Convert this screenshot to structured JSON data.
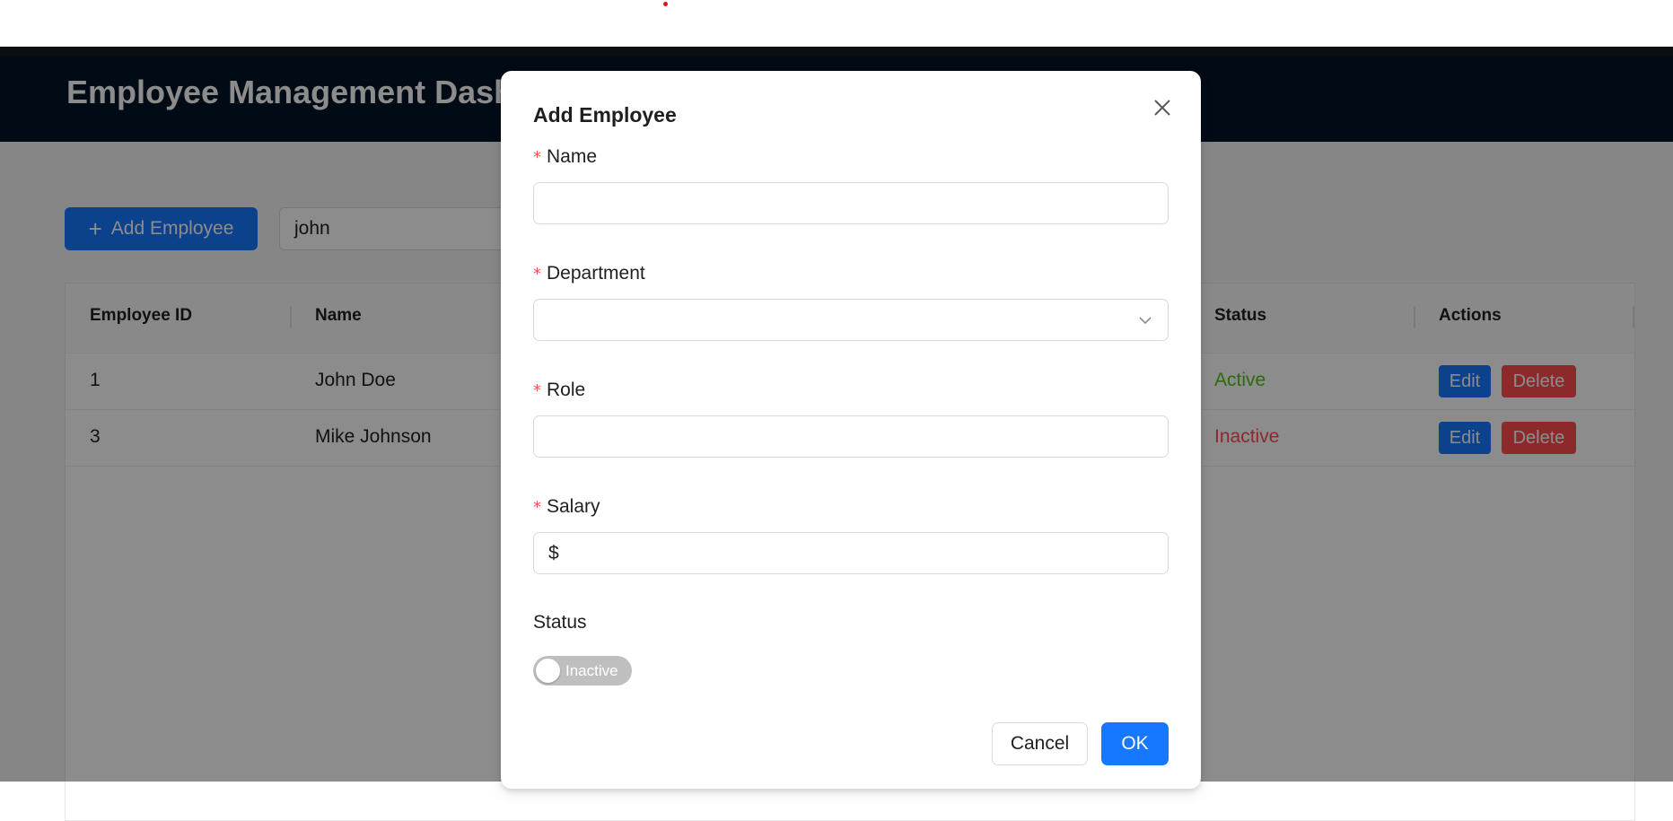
{
  "app": {
    "title": "Employee Management Dashboard",
    "add_button_label": "Add Employee",
    "search_value": "john",
    "table": {
      "columns": [
        "Employee ID",
        "Name",
        "Status",
        "Actions"
      ],
      "rows": [
        {
          "id": "1",
          "name": "John Doe",
          "status": "Active",
          "edit": "Edit",
          "delete": "Delete"
        },
        {
          "id": "3",
          "name": "Mike Johnson",
          "status": "Inactive",
          "edit": "Edit",
          "delete": "Delete"
        }
      ]
    }
  },
  "modal": {
    "title": "Add Employee",
    "fields": {
      "name_label": "Name",
      "name_value": "",
      "department_label": "Department",
      "department_value": "",
      "role_label": "Role",
      "role_value": "",
      "salary_label": "Salary",
      "salary_prefix": "$",
      "salary_value": "",
      "status_label": "Status",
      "status_toggle_text": "Inactive"
    },
    "required_marker": "*",
    "cancel_label": "Cancel",
    "ok_label": "OK"
  },
  "colors": {
    "primary": "#1677ff",
    "danger": "#ff4d4f",
    "success": "#52c41a",
    "header_bg": "#001529"
  },
  "icons": [
    "plus-icon",
    "close-icon",
    "chevron-down-icon"
  ]
}
